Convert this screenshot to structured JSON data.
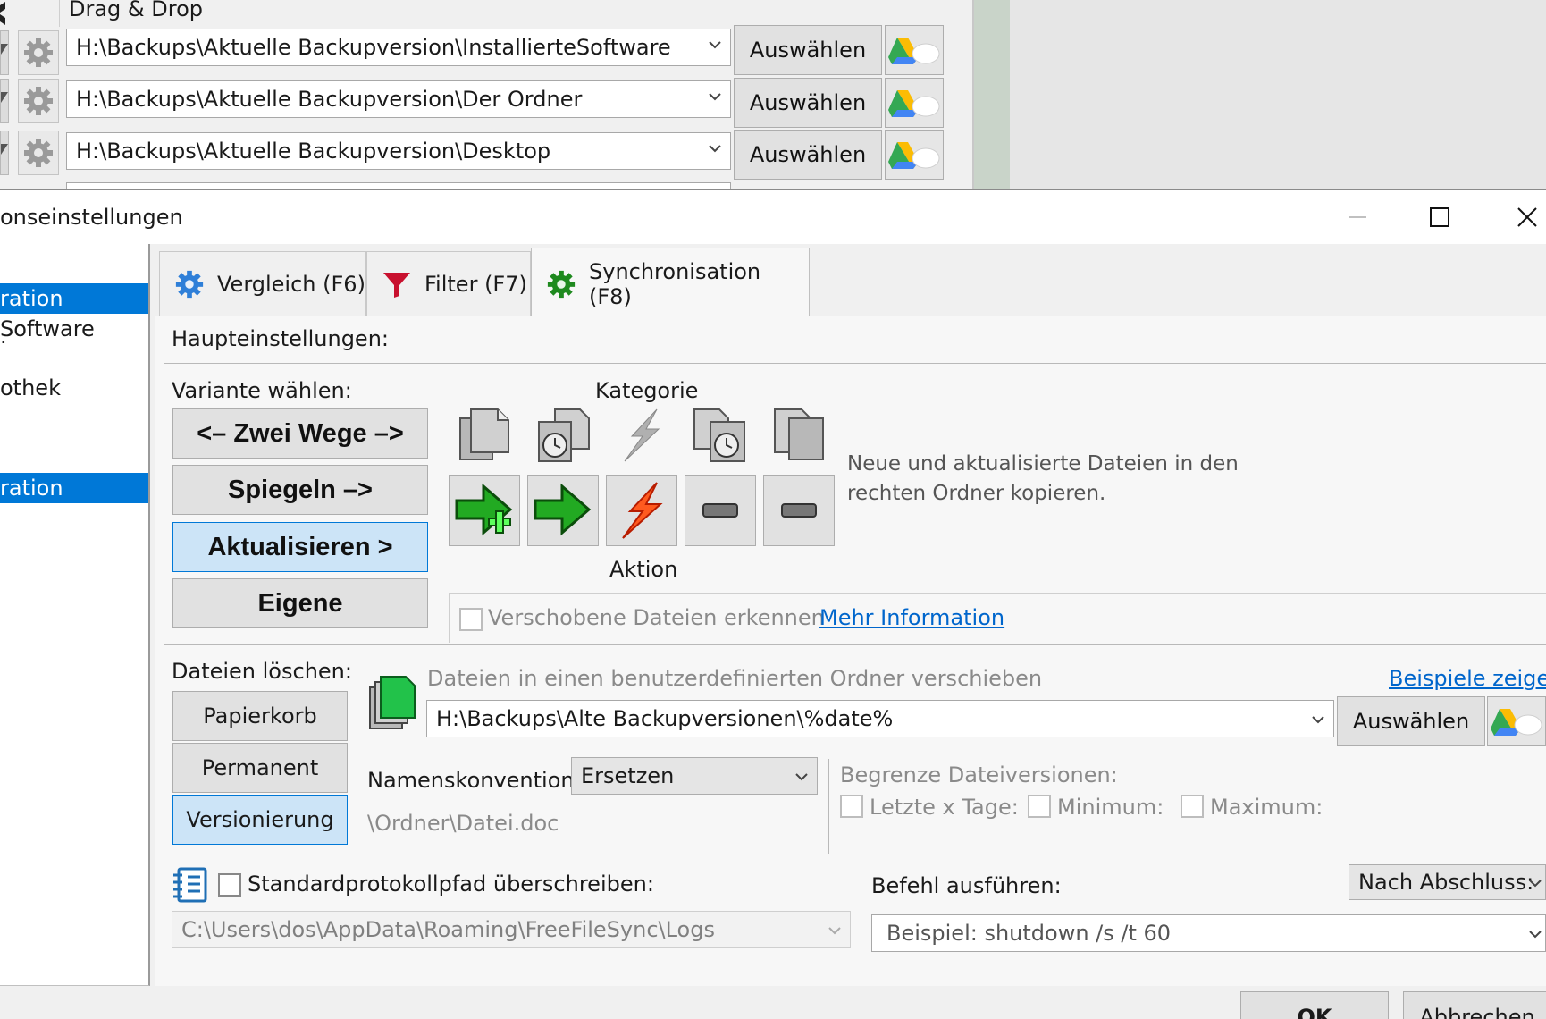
{
  "background_window": {
    "header_label": "Drag & Drop",
    "rows": [
      {
        "path": "H:\\Backups\\Aktuelle Backupversion\\InstallierteSoftware",
        "select_label": "Auswählen"
      },
      {
        "path": "H:\\Backups\\Aktuelle Backupversion\\Der Ordner",
        "select_label": "Auswählen"
      },
      {
        "path": "H:\\Backups\\Aktuelle Backupversion\\Desktop",
        "select_label": "Auswählen"
      }
    ]
  },
  "dialog": {
    "title": "onseinstellungen",
    "left_panel": {
      "items": [
        {
          "label": "ration",
          "selected": true
        },
        {
          "label": "Software",
          "selected": false
        },
        {
          "label": "·",
          "selected": false
        },
        {
          "label": "othek",
          "selected": false
        }
      ]
    },
    "tabs": [
      {
        "label": "Vergleich (F6)",
        "icon": "gear-blue-icon"
      },
      {
        "label": "Filter (F7)",
        "icon": "funnel-icon"
      },
      {
        "label": "Synchronisation (F8)",
        "icon": "gear-green-icon",
        "active": true
      }
    ],
    "main_settings_label": "Haupteinstellungen:",
    "variant": {
      "label": "Variante wählen:",
      "options": [
        {
          "label": "<– Zwei Wege –>",
          "selected": false
        },
        {
          "label": "Spiegeln –>",
          "selected": false
        },
        {
          "label": "Aktualisieren >",
          "selected": true
        },
        {
          "label": "Eigene",
          "selected": false
        }
      ]
    },
    "category_label": "Kategorie",
    "action_label": "Aktion",
    "variant_description": "Neue und aktualisierte Dateien in den rechten Ordner kopieren.",
    "detect_moved": {
      "label": "Verschobene Dateien erkennen",
      "checked": false,
      "link": "Mehr Information"
    },
    "delete_files": {
      "label": "Dateien löschen:",
      "options": [
        {
          "label": "Papierkorb",
          "selected": false
        },
        {
          "label": "Permanent",
          "selected": false
        },
        {
          "label": "Versionierung",
          "selected": true
        }
      ],
      "move_label": "Dateien in einen benutzerdefinierten Ordner verschieben",
      "examples_link": "Beispiele zeigen",
      "versioning_path": "H:\\Backups\\Alte Backupversionen\\%date%",
      "select_label": "Auswählen",
      "naming_label": "Namenskonvention:",
      "naming_value": "Ersetzen",
      "naming_example": "\\Ordner\\Datei.doc",
      "limit_label": "Begrenze Dateiversionen:",
      "limit_last_days": "Letzte x Tage:",
      "limit_min": "Minimum:",
      "limit_max": "Maximum:"
    },
    "log": {
      "override_label": "Standardprotokollpfad überschreiben:",
      "checked": false,
      "path": "C:\\Users\\dos\\AppData\\Roaming\\FreeFileSync\\Logs"
    },
    "command": {
      "label": "Befehl ausführen:",
      "when_value": "Nach Abschluss:",
      "placeholder": "Beispiel: shutdown /s /t 60"
    },
    "buttons": {
      "ok": "OK",
      "cancel": "Abbrechen"
    }
  },
  "colors": {
    "accent": "#0078d7",
    "selected_bg": "#cce4f7",
    "link": "#0066cc"
  }
}
